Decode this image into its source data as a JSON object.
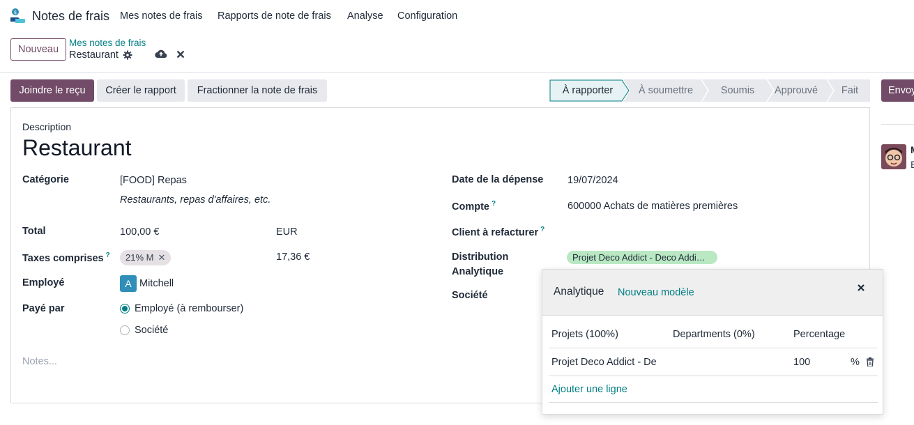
{
  "app": {
    "title": "Notes de frais",
    "logo_icon": "expense-app-logo"
  },
  "menu": [
    "Mes notes de frais",
    "Rapports de note de frais",
    "Analyse",
    "Configuration"
  ],
  "control": {
    "new_label": "Nouveau",
    "breadcrumb_parent": "Mes notes de frais",
    "breadcrumb_current": "Restaurant"
  },
  "actions": {
    "attach_receipt": "Joindre le reçu",
    "create_report": "Créer le rapport",
    "split_expense": "Fractionner la note de frais",
    "send_partial": "Envoy"
  },
  "stages": [
    "À rapporter",
    "À soumettre",
    "Soumis",
    "Approuvé",
    "Fait"
  ],
  "active_stage": "À rapporter",
  "form": {
    "description_label": "Description",
    "title": "Restaurant",
    "category_label": "Catégorie",
    "category_value": "[FOOD] Repas",
    "category_hint": "Restaurants, repas d'affaires, etc.",
    "total_label": "Total",
    "total_value": "100,00 €",
    "currency": "EUR",
    "taxes_label": "Taxes comprises",
    "tax_tag": "21% M",
    "tax_amount": "17,36 €",
    "employee_label": "Employé",
    "employee_initial": "A",
    "employee_name": "Mitchell",
    "paid_by_label": "Payé par",
    "paid_by_options": [
      "Employé (à rembourser)",
      "Société"
    ],
    "paid_by_selected": "Employé (à rembourser)",
    "notes_placeholder": "Notes...",
    "date_label": "Date de la dépense",
    "date_value": "19/07/2024",
    "account_label": "Compte",
    "account_value": "600000 Achats de matières premières",
    "client_label": "Client à refacturer",
    "distribution_label_1": "Distribution",
    "distribution_label_2": "Analytique",
    "distribution_tag": "Projet Deco Addict - Deco Addi…",
    "company_label": "Société",
    "help_mark": "?"
  },
  "chatter": {
    "name_initial": "M",
    "sub_initial": "E"
  },
  "popover": {
    "title": "Analytique",
    "new_model": "Nouveau modèle",
    "columns": [
      "Projets (100%)",
      "Departments (0%)",
      "Percentage"
    ],
    "row": {
      "project": "Projet Deco Addict  - De",
      "percentage": "100",
      "unit": "%"
    },
    "add_line": "Ajouter une ligne"
  },
  "colors": {
    "brand": "#714b67",
    "link": "#017e84",
    "analytic_tag": "#b9e8c3"
  }
}
